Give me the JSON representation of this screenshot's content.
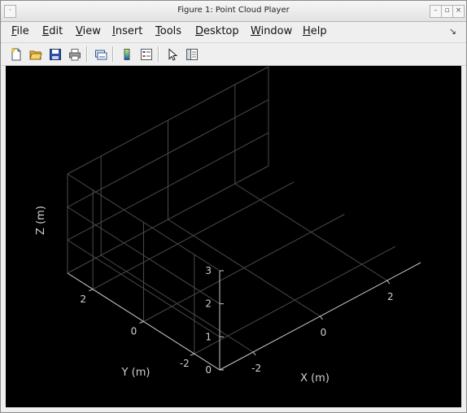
{
  "window": {
    "title": "Figure 1: Point Cloud Player",
    "left_btn": "·",
    "min_btn": "–",
    "max_btn": "▫",
    "close_btn": "×"
  },
  "menu": {
    "items": [
      "File",
      "Edit",
      "View",
      "Insert",
      "Tools",
      "Desktop",
      "Window",
      "Help"
    ],
    "dock_arrow": "↘"
  },
  "toolbar": {
    "icons": [
      "new-figure-icon",
      "open-file-icon",
      "save-icon",
      "print-icon",
      "link-plot-icon",
      "colorbar-icon",
      "legend-icon",
      "pointer-icon",
      "property-editor-icon"
    ]
  },
  "axes": {
    "xlabel": "X (m)",
    "ylabel": "Y (m)",
    "zlabel": "Z (m)",
    "x_ticks": [
      "-2",
      "0",
      "2"
    ],
    "y_ticks": [
      "2",
      "0",
      "-2"
    ],
    "z_ticks": [
      "0",
      "1",
      "2",
      "3"
    ],
    "background": "#000000",
    "grid_color": "#4a4a4a",
    "label_color": "#d0d0d0"
  },
  "chart_data": {
    "type": "scatter",
    "points": [],
    "xlabel": "X (m)",
    "ylabel": "Y (m)",
    "zlabel": "Z (m)",
    "xlim": [
      -3,
      3
    ],
    "ylim": [
      -3,
      3
    ],
    "zlim": [
      0,
      3
    ],
    "grid": true
  }
}
